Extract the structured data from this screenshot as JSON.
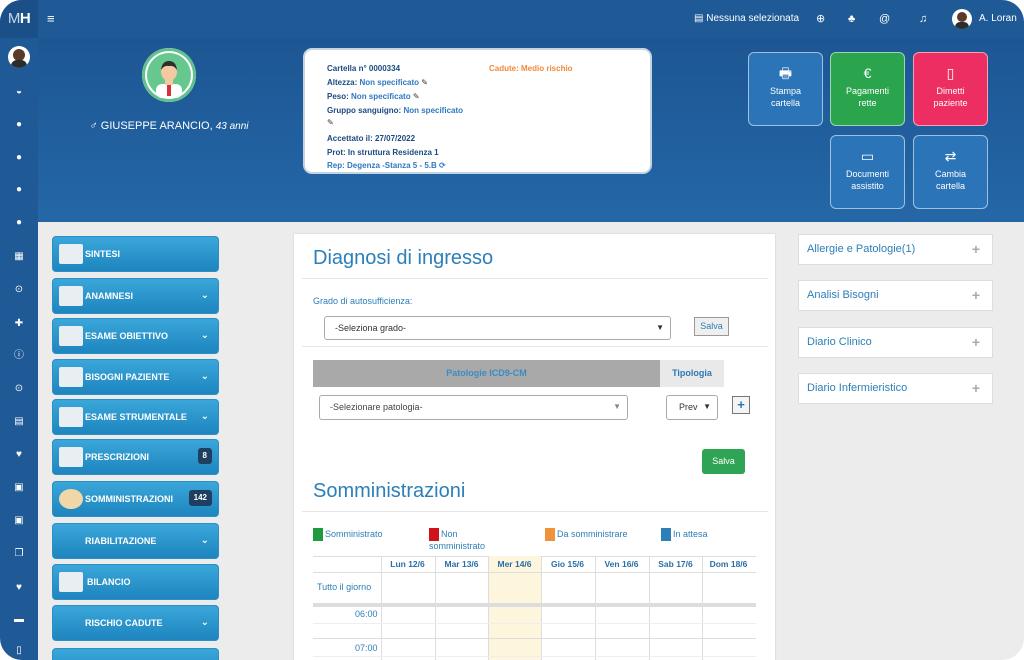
{
  "brand": {
    "logo_m": "M",
    "logo_h": "H"
  },
  "topbar": {
    "selection": "Nessuna selezionata",
    "user": "A. Loran"
  },
  "patient": {
    "name": "GIUSEPPE ARANCIO,",
    "age": "43 anni",
    "gender_symbol": "♂"
  },
  "card": {
    "cartella_label": "Cartella n° 0000334",
    "cadute": "Cadute: Medio rischio",
    "altezza_label": "Altezza:",
    "altezza_val": "Non specificato",
    "peso_label": "Peso:",
    "peso_val": "Non specificato",
    "gruppo_label": "Gruppo sanguigno:",
    "gruppo_val": "Non specificato",
    "accettato": "Accettato il: 27/07/2022",
    "prot": "Prot: In struttura Residenza 1",
    "rep": "Rep: Degenza -Stanza 5 - 5.B"
  },
  "tiles": [
    {
      "glyph": "🖶",
      "label1": "Stampa",
      "label2": "cartella",
      "color": "#2c74b8"
    },
    {
      "glyph": "€",
      "label1": "Pagamenti",
      "label2": "rette",
      "color": "#2aa54e"
    },
    {
      "glyph": "▯",
      "label1": "Dimetti",
      "label2": "paziente",
      "color": "#ec2e63"
    },
    {
      "glyph": "▭",
      "label1": "Documenti",
      "label2": "assistito",
      "color": "#2c74b8"
    },
    {
      "glyph": "⇄",
      "label1": "Cambia",
      "label2": "cartella",
      "color": "#2c74b8"
    }
  ],
  "menu": [
    {
      "label": "SINTESI",
      "chevron": "",
      "badge": ""
    },
    {
      "label": "ANAMNESI",
      "chevron": "⌄",
      "badge": ""
    },
    {
      "label": "ESAME OBIETTIVO",
      "chevron": "⌄",
      "badge": ""
    },
    {
      "label": "BISOGNI PAZIENTE",
      "chevron": "⌄",
      "badge": ""
    },
    {
      "label": "ESAME STRUMENTALE",
      "chevron": "⌄",
      "badge": ""
    },
    {
      "label": "PRESCRIZIONI",
      "chevron": "",
      "badge": "8"
    },
    {
      "label": "SOMMINISTRAZIONI",
      "chevron": "",
      "badge": "142"
    },
    {
      "label": "RIABILITAZIONE",
      "chevron": "⌄",
      "badge": ""
    },
    {
      "label": "BILANCIO",
      "chevron": "",
      "badge": ""
    },
    {
      "label": "RISCHIO CADUTE",
      "chevron": "⌄",
      "badge": ""
    }
  ],
  "diagnosi": {
    "title": "Diagnosi di ingresso",
    "grado_label": "Grado di autosufficienza:",
    "grado_select": "-Seleziona grado-",
    "salva1": "Salva",
    "col_patologie": "Patologie ICD9-CM",
    "col_tipologia": "Tipologia",
    "patologia_select": "-Selezionare patologia-",
    "tipologia_select": "Prev",
    "add": "+",
    "salva2": "Salva"
  },
  "somm": {
    "title": "Somministrazioni",
    "legend": [
      {
        "label": "Somministrato",
        "color": "#1f9a3c"
      },
      {
        "label": "Non somministrato",
        "color": "#d0121b"
      },
      {
        "label": "Da somministrare",
        "color": "#f0923a"
      },
      {
        "label": "In attesa",
        "color": "#2c7fb8"
      }
    ],
    "days": [
      "Lun 12/6",
      "Mar 13/6",
      "Mer 14/6",
      "Gio 15/6",
      "Ven 16/6",
      "Sab 17/6",
      "Dom 18/6"
    ],
    "allday": "Tutto il giorno",
    "hours": [
      "06:00",
      "07:00"
    ]
  },
  "accordions": [
    {
      "label": "Allergie e Patologie(1)"
    },
    {
      "label": "Analisi Bisogni"
    },
    {
      "label": "Diario Clinico"
    },
    {
      "label": "Diario Infermieristico"
    }
  ]
}
